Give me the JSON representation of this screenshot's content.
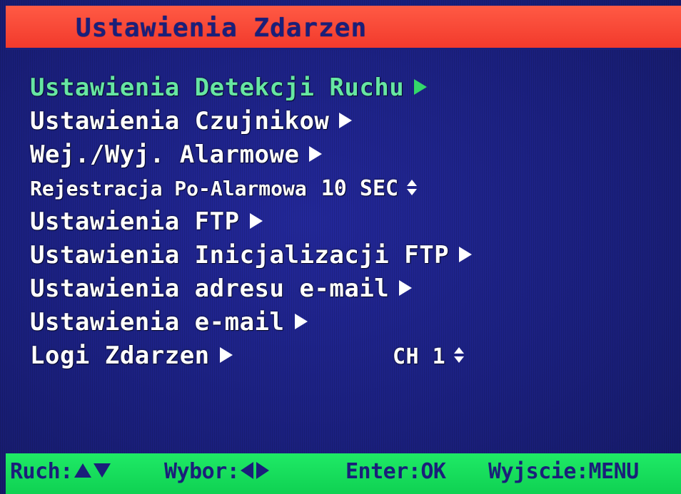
{
  "title": "Ustawienia Zdarzen",
  "menu": [
    {
      "label": "Ustawienia Detekcji Ruchu",
      "selected": true,
      "icon": "arrow-right-icon"
    },
    {
      "label": "Ustawienia Czujnikow",
      "icon": "arrow-right-icon"
    },
    {
      "label": "Wej./Wyj. Alarmowe",
      "icon": "arrow-right-icon"
    },
    {
      "label": "Rejestracja Po-Alarmowa",
      "value": "10 SEC",
      "icon": "up-down-icon"
    },
    {
      "label": "Ustawienia FTP",
      "icon": "arrow-right-icon"
    },
    {
      "label": "Ustawienia Inicjalizacji FTP",
      "icon": "arrow-right-icon"
    },
    {
      "label": "Ustawienia adresu e-mail",
      "icon": "arrow-right-icon"
    },
    {
      "label": "Ustawienia e-mail",
      "icon": "arrow-right-icon"
    },
    {
      "label": "Logi Zdarzen",
      "value": "CH 1",
      "icon": "arrow-right-icon",
      "value_icon": "up-down-icon"
    }
  ],
  "footer": {
    "move_label": "Ruch:",
    "select_label": "Wybor:",
    "enter_label": "Enter:OK",
    "exit_label": "Wyjscie:MENU"
  },
  "colors": {
    "background": "#1a1f7a",
    "title_bar": "#ff4a3a",
    "footer_bar": "#16e05c",
    "selected_text": "#66e6a3",
    "text": "#ffffff"
  }
}
